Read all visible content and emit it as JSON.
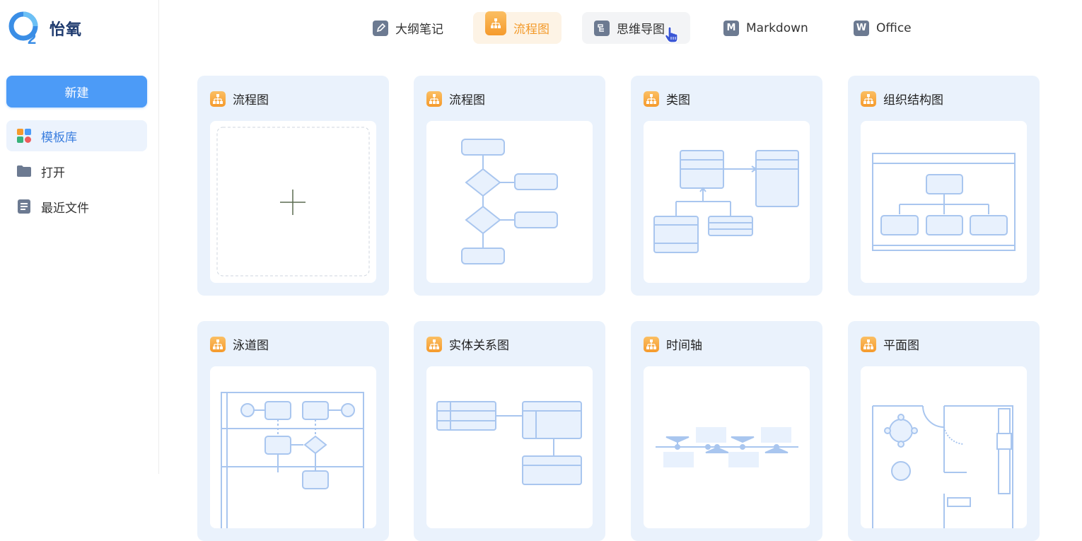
{
  "app": {
    "name": "怡氧"
  },
  "sidebar": {
    "new_label": "新建",
    "items": [
      {
        "label": "模板库",
        "icon": "grid-apps-icon",
        "active": true
      },
      {
        "label": "打开",
        "icon": "folder-icon",
        "active": false
      },
      {
        "label": "最近文件",
        "icon": "document-icon",
        "active": false
      }
    ]
  },
  "tabs": [
    {
      "label": "大纲笔记",
      "icon": "pen-icon"
    },
    {
      "label": "流程图",
      "icon": "flowchart-icon",
      "active": true
    },
    {
      "label": "思维导图",
      "icon": "mindmap-icon",
      "hover": true
    },
    {
      "label": "Markdown",
      "icon_text": "M"
    },
    {
      "label": "Office",
      "icon_text": "W"
    }
  ],
  "cards": [
    {
      "title": "流程图",
      "preview": "blank-new"
    },
    {
      "title": "流程图",
      "preview": "flowchart"
    },
    {
      "title": "类图",
      "preview": "class-diagram"
    },
    {
      "title": "组织结构图",
      "preview": "org-chart"
    },
    {
      "title": "泳道图",
      "preview": "swimlane"
    },
    {
      "title": "实体关系图",
      "preview": "er-diagram"
    },
    {
      "title": "时间轴",
      "preview": "timeline"
    },
    {
      "title": "平面图",
      "preview": "floor-plan"
    }
  ],
  "colors": {
    "accent": "#4c9bf7",
    "active_tab": "#f39a2a",
    "card_bg": "#eaf2fc",
    "diagram_stroke": "#a9c6ef",
    "diagram_fill": "#e8f1fd"
  }
}
